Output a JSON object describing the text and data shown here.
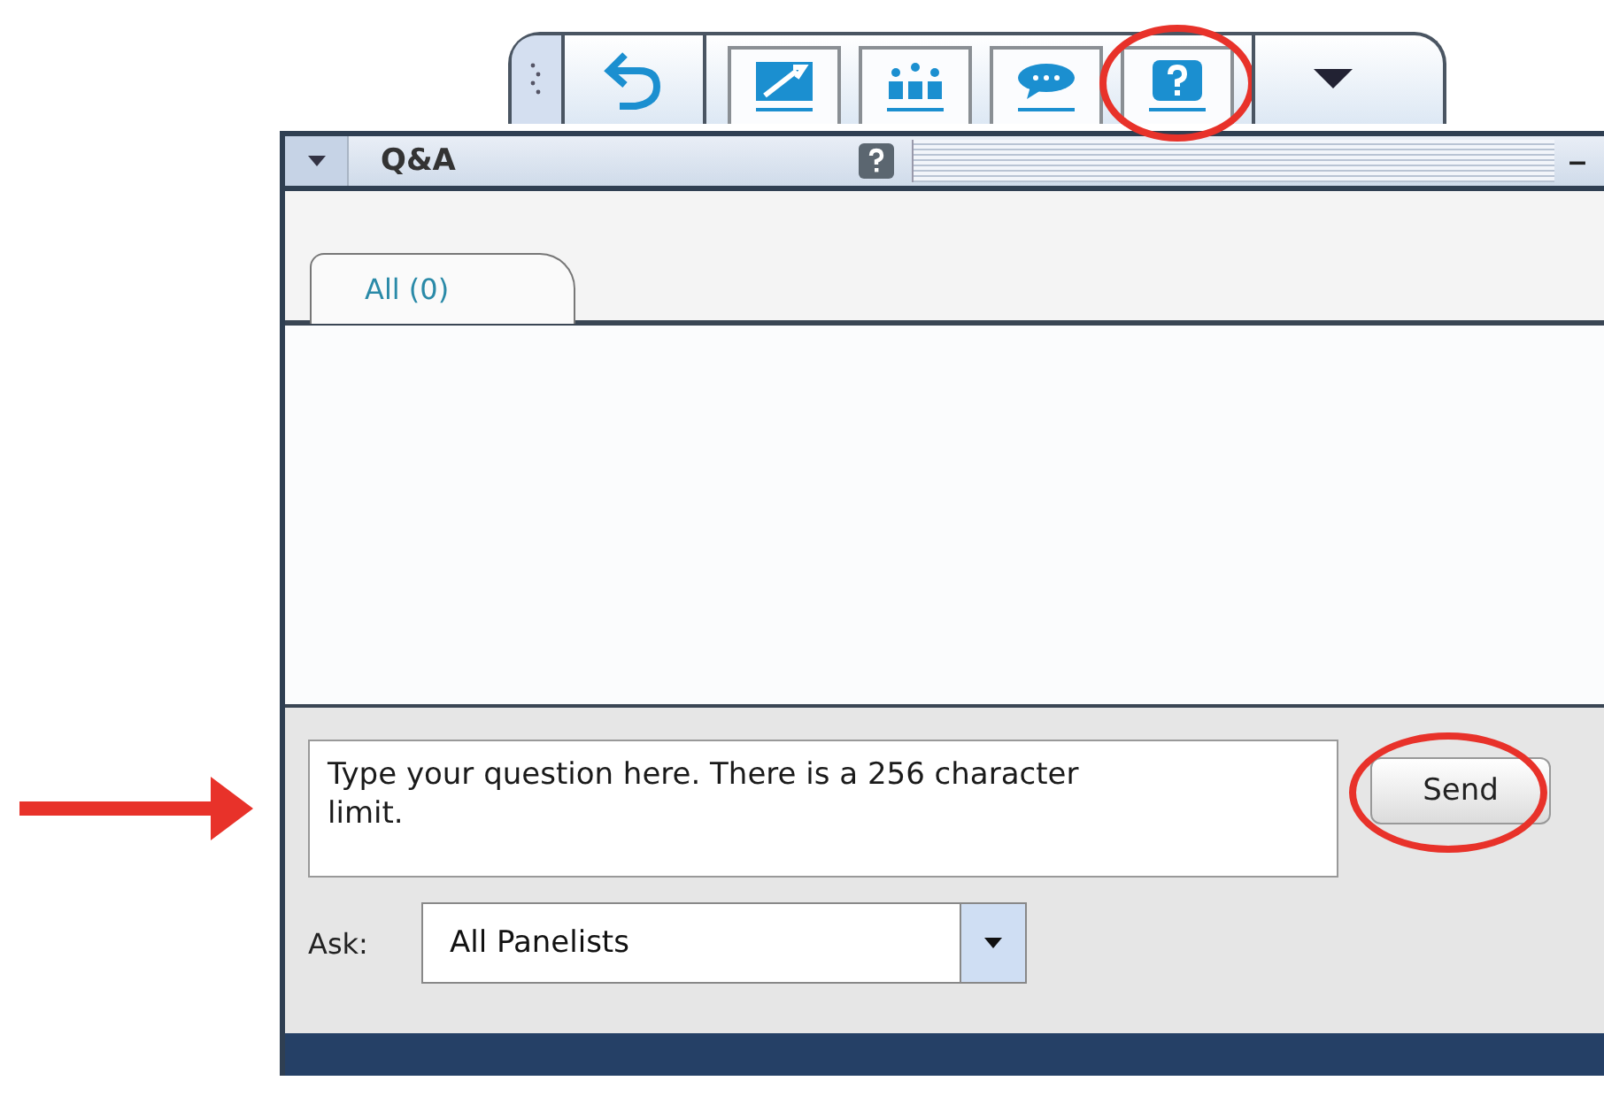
{
  "toolbar": {
    "buttons": [
      {
        "kind": "grip",
        "circled": false
      },
      {
        "kind": "undo",
        "circled": false
      },
      {
        "kind": "tools",
        "circled": false
      },
      {
        "kind": "participants",
        "circled": false
      },
      {
        "kind": "chat",
        "circled": false
      },
      {
        "kind": "help",
        "circled": true
      },
      {
        "kind": "dropdown",
        "circled": false
      }
    ]
  },
  "panel": {
    "title": "Q&A",
    "minimize": "–",
    "tabs": [
      {
        "label": "All (0)",
        "selected": true
      }
    ],
    "question": {
      "placeholder": "Type your question here. There is a 256 character limit.",
      "pointed_at": true
    },
    "send_button": {
      "label": "Send",
      "circled": true
    },
    "ask": {
      "label": "Ask:",
      "value": "All Panelists"
    }
  }
}
